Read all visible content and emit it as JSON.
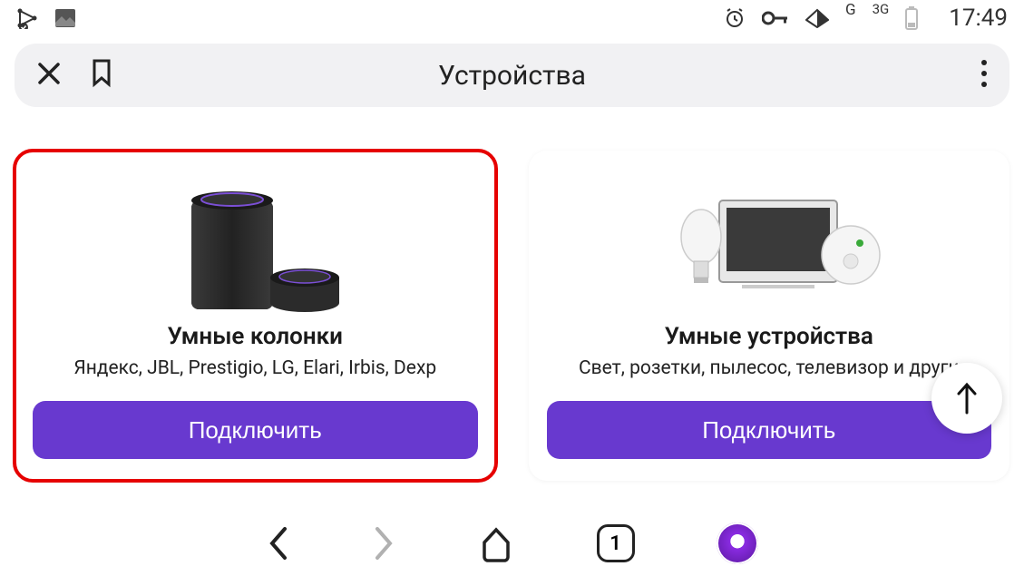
{
  "status": {
    "network1": "G",
    "network2": "3G",
    "time": "17:49"
  },
  "header": {
    "title": "Устройства"
  },
  "cards": [
    {
      "title": "Умные колонки",
      "subtitle": "Яндекс, JBL, Prestigio, LG, Elari, Irbis, Dexp",
      "button": "Подключить"
    },
    {
      "title": "Умные устройства",
      "subtitle": "Свет, розетки, пылесос, телевизор и други",
      "button": "Подключить"
    }
  ],
  "bottomNav": {
    "tabCount": "1"
  }
}
